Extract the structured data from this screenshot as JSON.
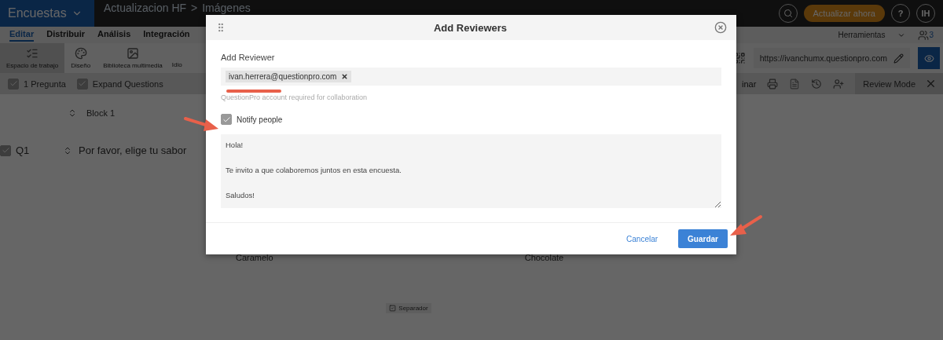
{
  "top_bar": {
    "product": "Encuestas",
    "breadcrumb": [
      "Actualizacion HF",
      "Imágenes"
    ],
    "breadcrumb_separator": ">",
    "update_button": "Actualizar ahora",
    "help": "?",
    "avatar": "IH"
  },
  "nav_tabs": [
    {
      "label": "Editar",
      "selected": true
    },
    {
      "label": "Distribuir",
      "selected": false
    },
    {
      "label": "Análisis",
      "selected": false
    },
    {
      "label": "Integración",
      "selected": false
    }
  ],
  "tools_menu": {
    "label": "Herramientas",
    "collaborators": "3"
  },
  "toolbar": [
    {
      "label": "Espacio de trabajo",
      "selected": true
    },
    {
      "label": "Diseño",
      "selected": false
    },
    {
      "label": "Biblioteca multimedia",
      "selected": false
    },
    {
      "label": "Idio",
      "selected": false
    }
  ],
  "survey_url": "https://ivanchumx.questionpro.com",
  "options": [
    {
      "label": "1 Pregunta",
      "checked": true
    },
    {
      "label": "Expand Questions",
      "checked": true
    }
  ],
  "actions": {
    "partial_label": "inar",
    "review_mode": "Review Mode"
  },
  "block": "Block 1",
  "question": {
    "number": "Q1",
    "text": "Por favor, elige tu sabor",
    "checked": true
  },
  "choices": [
    "Caramelo",
    "Chocolate"
  ],
  "separator": {
    "label": "Separador",
    "checked": true
  },
  "dialog": {
    "title": "Add Reviewers",
    "field_label": "Add Reviewer",
    "tags": [
      "ivan.herrera@questionpro.com"
    ],
    "hint": "QuestionPro account required for collaboration",
    "notify": {
      "label": "Notify people",
      "checked": true
    },
    "message": "Hola!\n\nTe invito a que colaboremos juntos en esta encuesta.\n\nSaludos!",
    "cancel": "Cancelar",
    "save": "Guardar"
  }
}
